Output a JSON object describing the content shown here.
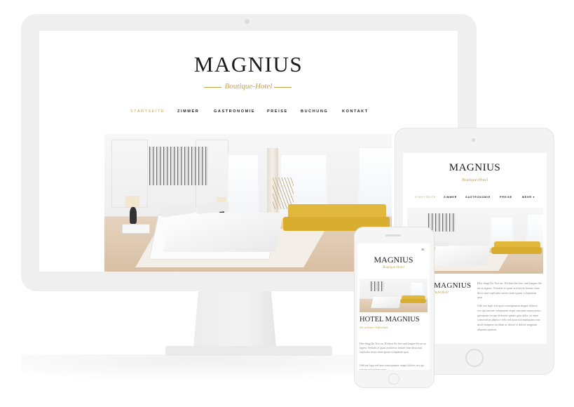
{
  "desktop": {
    "logo": "MAGNIUS",
    "subtitle": "Boutique-Hotel",
    "nav": [
      "STARTSEITE",
      "ZIMMER",
      "GASTRONOMIE",
      "PREISE",
      "BUCHUNG",
      "KONTAKT"
    ],
    "active_nav": "STARTSEITE"
  },
  "tablet": {
    "logo": "MAGNIUS",
    "subtitle": "Boutique-Hotel",
    "nav": [
      "STARTSEITE",
      "ZIMMER",
      "GASTRONOMIE",
      "PREISE",
      "MEHR ▾"
    ],
    "heading_fragment": "MAGNIUS",
    "kicker_fragment": "Aufenthalt",
    "paragraph1": "Hier fängt Ihr Text an. Klicken Sie hier und fangen Sie an zu tippen. Veritatis et quasi architecto beatae vitae dicta sunt explicabo nemo enim ipsam voluptatem quia.",
    "paragraph2": "Odit aut fugit sed quia consequuntur magni dolores eos qui ratione voluptatem sequi nesciunt neque porro quisquam est qui dolorem ipsum quia dolor sit amet consectetur adipisci velit sed quia non numquam eius modi tempora incidunt ut labore et dolore magnam aliquam quaerat."
  },
  "phone": {
    "logo": "MAGNIUS",
    "subtitle": "Boutique-Hotel",
    "menu_icon": "≡",
    "heading": "HOTEL MAGNIUS",
    "kicker": "Ihr schöner Aufenthalt",
    "paragraph1": "Hier fängt Ihr Text an. Klicken Sie hier und fangen Sie an zu tippen. Veritatis et quasi architecto beatae vitae dicta sunt explicabo nemo enim ipsam voluptatem quia.",
    "paragraph2": "Odit aut fugit sed quia consequuntur magni dolores eos qui ratione voluptatem sequi"
  },
  "colors": {
    "accent": "#c9a24b",
    "device_frame": "#efefef",
    "text_dark": "#1a1a1a",
    "sofa": "#d9ad2f"
  }
}
